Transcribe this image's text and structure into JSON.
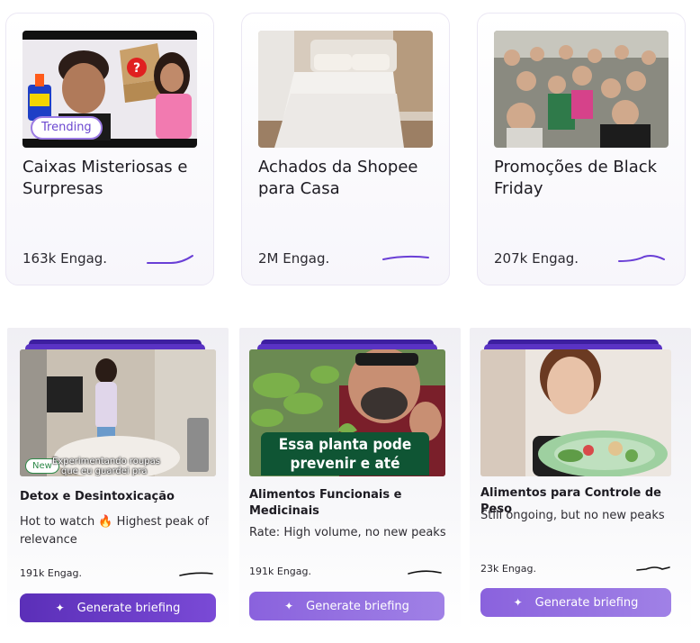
{
  "top_cards": [
    {
      "title": "Caixas Misteriosas e Surpresas",
      "engagement": "163k Engag.",
      "badge": "Trending"
    },
    {
      "title": "Achados da Shopee para Casa",
      "engagement": "2M Engag."
    },
    {
      "title": "Promoções de Black Friday",
      "engagement": "207k Engag."
    }
  ],
  "bottom_cards": [
    {
      "title": "Detox e Desintoxicação",
      "description": "Hot to watch 🔥 Highest peak of relevance",
      "engagement": "191k Engag.",
      "badge": "New",
      "overlay_line1": "Experimentando roupas",
      "overlay_line2": "que eu guardei pra",
      "button": "Generate briefing"
    },
    {
      "title": "Alimentos Funcionais e Medicinais",
      "description": "Rate: High volume, no new peaks",
      "engagement": "191k Engag.",
      "banner_line1": "Essa planta pode",
      "banner_line2": "prevenir e até reverter",
      "button": "Generate briefing"
    },
    {
      "title": "Alimentos para Controle de Peso",
      "description": "Still ongoing, but no new peaks",
      "engagement": "23k Engag.",
      "button": "Generate briefing"
    }
  ],
  "colors": {
    "accent": "#6b47d0",
    "sparkline": "#6a3fd6",
    "button_dark": "#5b2fb8",
    "button_light": "#9472e2"
  },
  "icons": {
    "sparkle": "sparkle-icon",
    "fire": "fire-icon"
  }
}
